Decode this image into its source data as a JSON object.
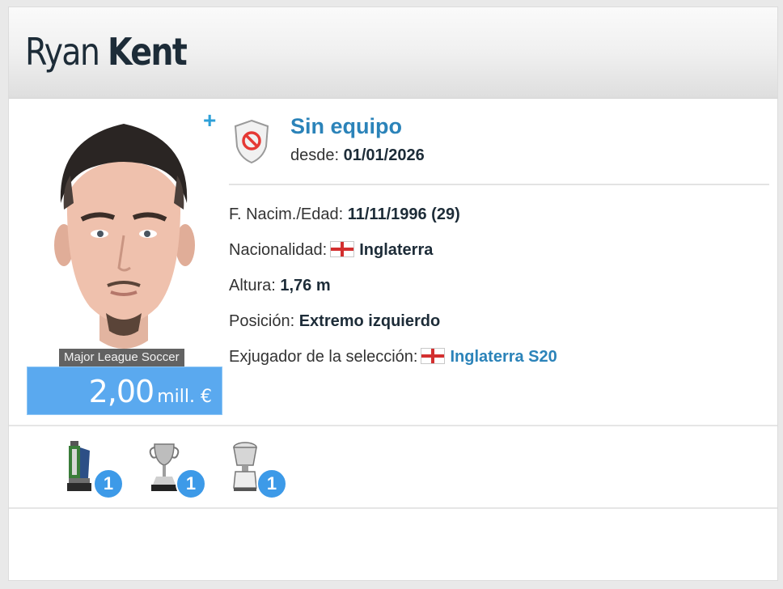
{
  "player": {
    "first_name": "Ryan",
    "last_name": "Kent",
    "league_label": "Major League Soccer",
    "market_value": {
      "amount": "2,00",
      "unit": "mill. €"
    }
  },
  "club": {
    "name": "Sin equipo",
    "since_label": "desde:",
    "since_value": "01/01/2026"
  },
  "info": {
    "birth_label": "F. Nacim./Edad:",
    "birth_value": "11/11/1996 (29)",
    "nationality_label": "Nacionalidad:",
    "nationality_value": "Inglaterra",
    "height_label": "Altura:",
    "height_value": "1,76 m",
    "position_label": "Posición:",
    "position_value": "Extremo izquierdo",
    "national_label": "Exjugador de la selección:",
    "national_value": "Inglaterra S20"
  },
  "trophies": [
    {
      "icon": "league-cup-trophy-icon",
      "count": "1"
    },
    {
      "icon": "cup-trophy-icon",
      "count": "1"
    },
    {
      "icon": "super-cup-trophy-icon",
      "count": "1"
    }
  ],
  "colors": {
    "accent": "#2b83b9",
    "market_value_bg": "#5aa9ef",
    "badge": "#3d9ae8",
    "flag_red": "#d32f2f"
  }
}
